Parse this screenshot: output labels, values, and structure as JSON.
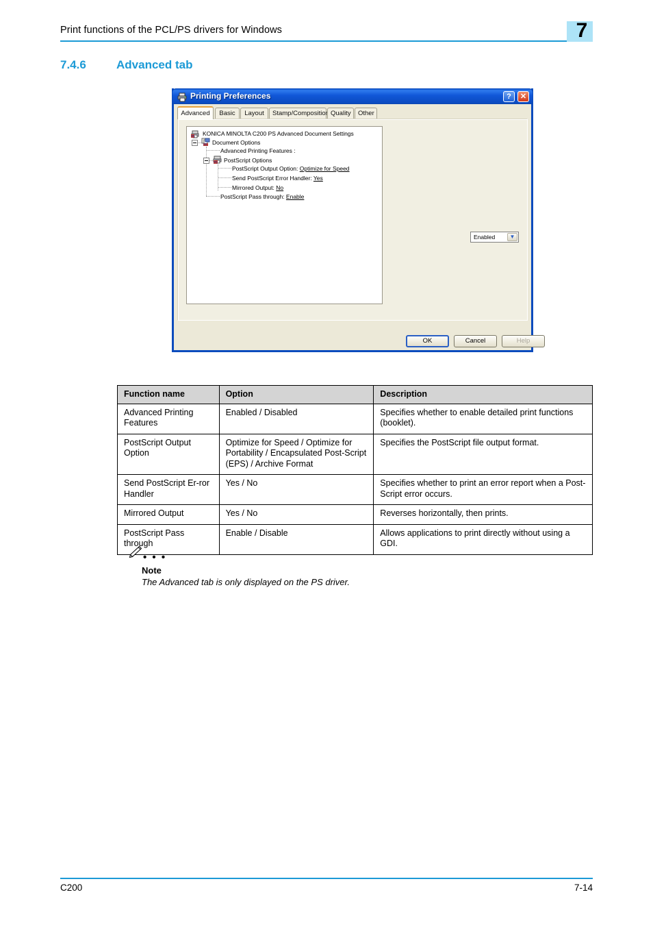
{
  "header": {
    "title": "Print functions of the PCL/PS drivers for Windows",
    "chapter": "7",
    "rule_color": "#1b9ad6",
    "badge_color": "#ade3f7"
  },
  "section": {
    "number": "7.4.6",
    "title": "Advanced tab",
    "color": "#1b9ad6"
  },
  "dialog": {
    "title": "Printing Preferences",
    "icon": "printer-icon",
    "help_button": "?",
    "close_button": "✕",
    "tabs": [
      {
        "label": "Advanced",
        "active": true
      },
      {
        "label": "Basic",
        "active": false
      },
      {
        "label": "Layout",
        "active": false
      },
      {
        "label": "Stamp/Composition",
        "active": false
      },
      {
        "label": "Quality",
        "active": false
      },
      {
        "label": "Other",
        "active": false
      }
    ],
    "tree": {
      "root_label": "KONICA MINOLTA C200 PS Advanced Document Settings",
      "document_options_label": "Document Options",
      "advanced_printing_features_label": "Advanced Printing Features :",
      "advanced_printing_features_value": "Enabled",
      "postscript_options_label": "PostScript Options",
      "postscript_output_option_label": "PostScript Output Option:",
      "postscript_output_option_value": "Optimize for Speed",
      "send_postscript_error_handler_label": "Send PostScript Error Handler:",
      "send_postscript_error_handler_value": "Yes",
      "mirrored_output_label": "Mirrored Output:",
      "mirrored_output_value": "No",
      "postscript_pass_through_label": "PostScript Pass through:",
      "postscript_pass_through_value": "Enable"
    },
    "buttons": {
      "ok": "OK",
      "cancel": "Cancel",
      "help": "Help"
    }
  },
  "table": {
    "columns": [
      "Function name",
      "Option",
      "Description"
    ],
    "rows": [
      {
        "function_name": "Advanced Printing Features",
        "option": "Enabled / Disabled",
        "description": "Specifies whether to enable detailed print functions (booklet)."
      },
      {
        "function_name": "PostScript Output Option",
        "option": "Optimize for Speed / Optimize for Portability / Encapsulated Post-Script (EPS) / Archive Format",
        "description": "Specifies the PostScript file output format."
      },
      {
        "function_name": "Send PostScript Er-ror Handler",
        "option": "Yes / No",
        "description": "Specifies whether to print an error report when a Post-Script error occurs."
      },
      {
        "function_name": "Mirrored Output",
        "option": "Yes / No",
        "description": "Reverses horizontally, then prints."
      },
      {
        "function_name": "PostScript Pass through",
        "option": "Enable / Disable",
        "description": "Allows applications to print directly without using a GDI."
      }
    ]
  },
  "note": {
    "icon": "pencil-icon",
    "dots": "• • •",
    "label": "Note",
    "text": "The Advanced tab is only displayed on the PS driver."
  },
  "footer": {
    "left": "C200",
    "right": "7-14"
  }
}
